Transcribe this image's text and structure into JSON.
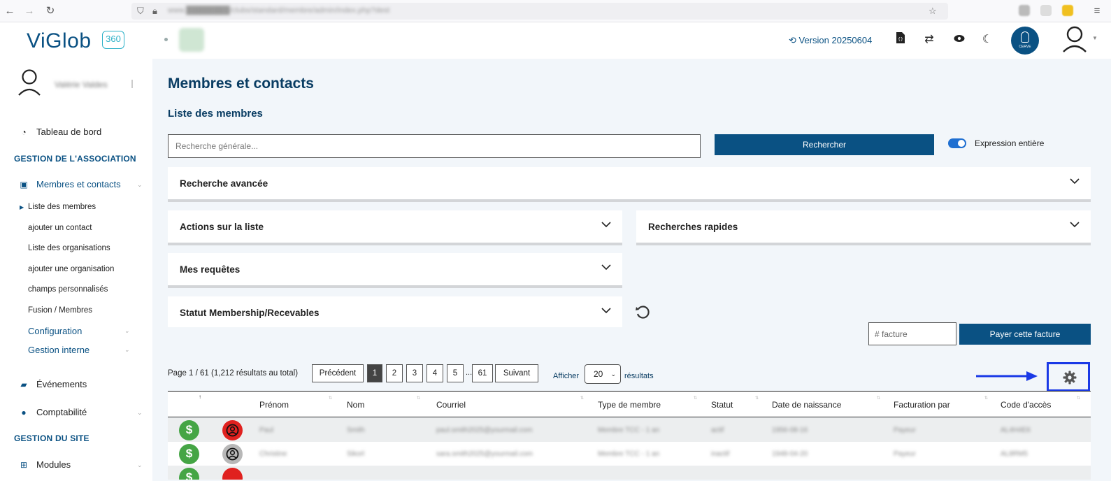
{
  "app": {
    "logo_text": "ViGlob",
    "logo_badge": "360",
    "version": "Version 20250604",
    "cerve_label": "CERVE"
  },
  "browser": {
    "url": "www.████████/clubs/standard/membre/admin/index.php?dest"
  },
  "sidebar": {
    "user_name": "Valérie Valdes",
    "dashboard": "Tableau de bord",
    "section_association": "GESTION DE L'ASSOCIATION",
    "members_contacts": "Membres et contacts",
    "sub_items": [
      "Liste des membres",
      "ajouter un contact",
      "Liste des organisations",
      "ajouter une organisation",
      "champs personnalisés",
      "Fusion / Membres"
    ],
    "configuration": "Configuration",
    "internal": "Gestion interne",
    "events": "Événements",
    "accounting": "Comptabilité",
    "section_site": "GESTION DU SITE",
    "modules": "Modules"
  },
  "main": {
    "title": "Membres et contacts",
    "subtitle": "Liste des membres",
    "search_placeholder": "Recherche générale...",
    "search_button": "Rechercher",
    "toggle_label": "Expression entière",
    "panels": {
      "advanced": "Recherche avancée",
      "actions": "Actions sur la liste",
      "quick": "Recherches rapides",
      "queries": "Mes requêtes",
      "status": "Statut Membership/Recevables"
    },
    "facture_placeholder": "# facture",
    "pay_button": "Payer cette facture",
    "pager_info": "Page 1 / 61 (1,212 résultats au total)",
    "pager": {
      "prev": "Précédent",
      "pages": [
        "1",
        "2",
        "3",
        "4",
        "5"
      ],
      "ellipsis": "...",
      "last": "61",
      "next": "Suivant"
    },
    "show_label": "Afficher",
    "page_size": "20",
    "results_label": "résultats"
  },
  "table": {
    "headers": [
      "Prénom",
      "Nom",
      "Courriel",
      "Type de membre",
      "Statut",
      "Date de naissance",
      "Facturation par",
      "Code d'accès"
    ],
    "rows": [
      {
        "status_color": "red",
        "cells": [
          "Paul",
          "Smith",
          "paul.smith2025@yourmail.com",
          "Membre TCC - 1 an",
          "actif",
          "1956-08-16",
          "Payeur",
          "AL4H4E6"
        ]
      },
      {
        "status_color": "gray",
        "cells": [
          "Christine",
          "Sikorl",
          "sara.smith2025@yourmail.com",
          "Membre TCC - 1 an",
          "inactif",
          "1948-04-20",
          "Payeur",
          "AL8RM5"
        ]
      }
    ]
  },
  "colors": {
    "primary": "#0a5183",
    "highlight": "#1a39e6",
    "pay_green": "#45a545",
    "status_red": "#e0211f",
    "status_gray": "#b8b8b8"
  }
}
